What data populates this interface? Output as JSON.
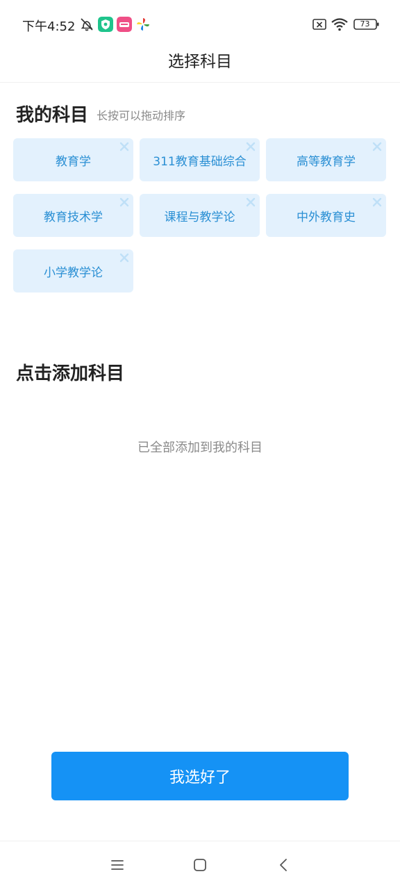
{
  "status_bar": {
    "time": "下午4:52",
    "battery": "73",
    "icons": [
      "alarm-off-icon",
      "green-app-icon",
      "pink-app-icon",
      "pinwheel-app-icon",
      "sim-off-icon",
      "wifi-icon",
      "battery-icon"
    ]
  },
  "header": {
    "title": "选择科目"
  },
  "my_subjects": {
    "title": "我的科目",
    "hint": "长按可以拖动排序",
    "items": [
      {
        "label": "教育学"
      },
      {
        "label": "311教育基础综合"
      },
      {
        "label": "高等教育学"
      },
      {
        "label": "教育技术学"
      },
      {
        "label": "课程与教学论"
      },
      {
        "label": "中外教育史"
      },
      {
        "label": "小学教学论"
      }
    ],
    "remove_icon": "close-icon"
  },
  "add_subjects": {
    "title": "点击添加科目",
    "empty_text": "已全部添加到我的科目"
  },
  "confirm_button": {
    "label": "我选好了"
  },
  "colors": {
    "accent": "#1592f5",
    "chip_bg": "#e3f1fd",
    "chip_text": "#2a8fd4",
    "chip_close": "#bfe0f7"
  },
  "nav_bar": {
    "icons": [
      "menu-icon",
      "home-icon",
      "back-icon"
    ]
  }
}
